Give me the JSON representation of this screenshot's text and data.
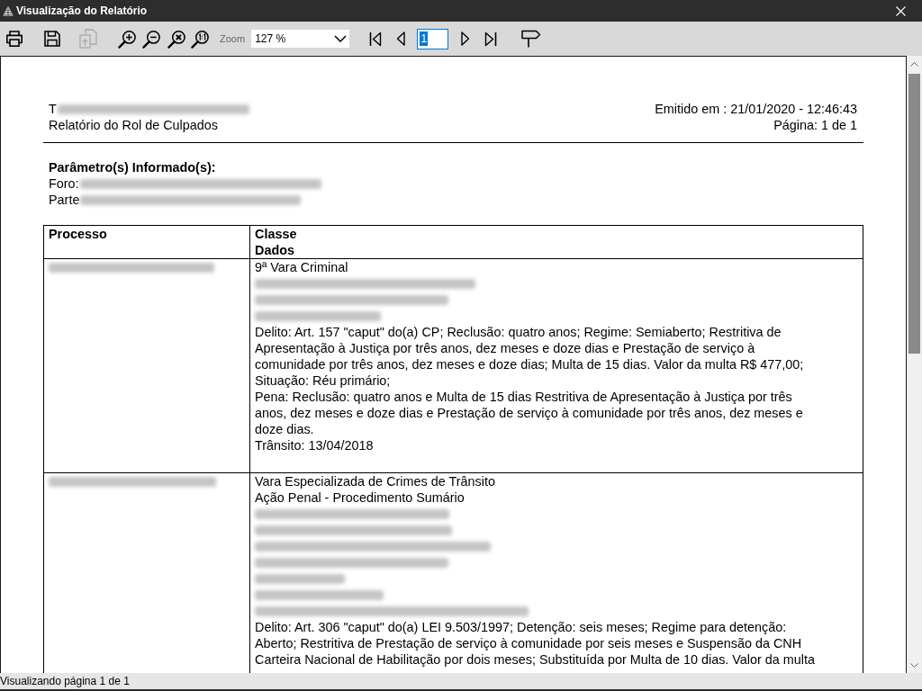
{
  "window": {
    "title": "Visualização do Relatório"
  },
  "toolbar": [
    {
      "kind": "button",
      "disabled": false
    },
    {
      "kind": "button",
      "disabled": false
    },
    {
      "kind": "button",
      "disabled": true
    },
    {
      "kind": "button",
      "disabled": false
    },
    {
      "kind": "button",
      "disabled": false
    },
    {
      "kind": "button",
      "disabled": false
    },
    {
      "kind": "button",
      "disabled": false
    },
    {
      "kind": "label",
      "text": "Zoom"
    },
    {
      "kind": "combobox",
      "value": "127 %"
    },
    {
      "kind": "button",
      "disabled": false
    },
    {
      "kind": "button",
      "disabled": false
    },
    {
      "kind": "page_field",
      "value": "1",
      "text_selected": true
    },
    {
      "kind": "button",
      "disabled": false
    },
    {
      "kind": "button",
      "disabled": false
    },
    {
      "kind": "button",
      "disabled": false
    }
  ],
  "report": {
    "header_left": [
      {
        "parts": [
          {
            "kind": "text",
            "text": "T"
          },
          {
            "kind": "redacted"
          }
        ]
      },
      {
        "parts": [
          {
            "kind": "text",
            "text": "Relatório do Rol de Culpados"
          }
        ]
      }
    ],
    "header_right": [
      "Emitido em : 21/01/2020 - 12:46:43",
      "Página: 1 de 1"
    ],
    "parameters": {
      "title": "Parâmetro(s) Informado(s):",
      "lines": [
        {
          "parts": [
            {
              "kind": "text",
              "text": "Foro:"
            },
            {
              "kind": "redacted"
            }
          ]
        },
        {
          "parts": [
            {
              "kind": "text",
              "text": "Parte"
            },
            {
              "kind": "redacted"
            }
          ]
        }
      ]
    },
    "table": {
      "columns": [
        {
          "lines": [
            "Processo"
          ]
        },
        {
          "lines": [
            "Classe",
            "Dados"
          ]
        }
      ],
      "rows": [
        {
          "cells": [
            [
              {
                "kind": "redacted"
              }
            ],
            [
              {
                "kind": "text",
                "text": "9ª Vara Criminal"
              },
              {
                "kind": "redacted"
              },
              {
                "kind": "redacted"
              },
              {
                "kind": "redacted"
              },
              {
                "kind": "text",
                "text": "Delito: Art. 157 \"caput\" do(a) CP; Reclusão: quatro anos; Regime: Semiaberto; Restritiva de Apresentação à Justiça por três anos, dez meses e doze dias e Prestação de serviço à comunidade por três anos, dez meses e doze dias; Multa de 15 dias. Valor da multa R$ 477,00;"
              },
              {
                "kind": "text",
                "text": "Situação: Réu primário;"
              },
              {
                "kind": "text",
                "text": "Pena: Reclusão: quatro anos e Multa de 15 dias Restritiva de Apresentação à Justiça por três anos, dez meses e doze dias e Prestação de serviço à comunidade por três anos, dez meses e doze dias."
              },
              {
                "kind": "text",
                "text": "Trânsito: 13/04/2018"
              }
            ]
          ]
        },
        {
          "cells": [
            [
              {
                "kind": "redacted"
              }
            ],
            [
              {
                "kind": "text",
                "text": "Vara Especializada de Crimes de Trânsito"
              },
              {
                "kind": "text",
                "text": "Ação Penal - Procedimento Sumário"
              },
              {
                "kind": "redacted"
              },
              {
                "kind": "redacted"
              },
              {
                "kind": "redacted"
              },
              {
                "kind": "redacted"
              },
              {
                "kind": "redacted"
              },
              {
                "kind": "redacted"
              },
              {
                "kind": "redacted"
              },
              {
                "kind": "text",
                "text": "Delito: Art. 306 \"caput\" do(a) LEI 9.503/1997; Detenção: seis meses; Regime para detenção: Aberto; Restritiva de Prestação de serviço à comunidade por seis meses e Suspensão da CNH Carteira Nacional de Habilitação por dois meses; Substituída por Multa de 10 dias. Valor da multa"
              }
            ]
          ]
        }
      ]
    }
  },
  "status_bar": {
    "text": "Visualizando página 1 de 1"
  }
}
